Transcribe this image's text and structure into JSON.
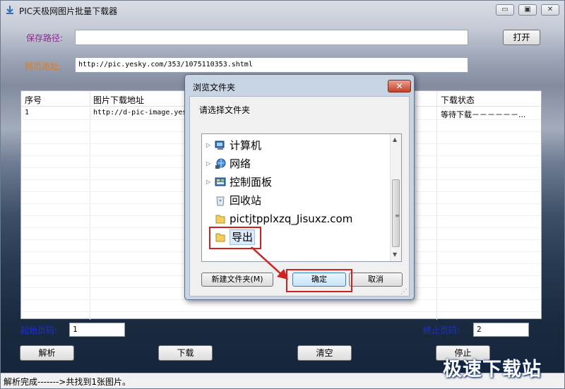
{
  "window": {
    "title": "PIC天极网图片批量下载器",
    "minimize": "▭",
    "maximize": "▣",
    "close": "✕"
  },
  "form": {
    "save_path_label": "保存路径:",
    "save_path_value": "",
    "open_button": "打开",
    "url_label": "网页地址:",
    "url_value": "http://pic.yesky.com/353/1075110353.shtml"
  },
  "table": {
    "columns": [
      "序号",
      "图片下载地址",
      "下载状态"
    ],
    "rows": [
      {
        "index": "1",
        "url": "http://d-pic-image.yes",
        "status": "等待下载－－－－－－..."
      }
    ]
  },
  "pages": {
    "start_label": "起始页码:",
    "start_value": "1",
    "end_label": "终止页码:",
    "end_value": "2"
  },
  "actions": {
    "parse": "解析",
    "download": "下载",
    "clear": "清空",
    "stop": "停止"
  },
  "status": "解析完成------->共找到1张图片。",
  "watermark": "极速下载站",
  "dialog": {
    "title": "浏览文件夹",
    "close": "✕",
    "prompt": "请选择文件夹",
    "tree": [
      {
        "label": "计算机",
        "icon": "computer-icon",
        "expandable": true
      },
      {
        "label": "网络",
        "icon": "network-icon",
        "expandable": true
      },
      {
        "label": "控制面板",
        "icon": "control-panel-icon",
        "expandable": true
      },
      {
        "label": "回收站",
        "icon": "recycle-bin-icon",
        "expandable": false
      },
      {
        "label": "pictjtpplxzq_Jisuxz.com",
        "icon": "folder-icon",
        "expandable": false
      },
      {
        "label": "导出",
        "icon": "folder-icon",
        "expandable": false,
        "selected": true
      }
    ],
    "new_folder": "新建文件夹(M)",
    "ok": "确定",
    "cancel": "取消"
  },
  "colors": {
    "label_purple": "#8b2d8f",
    "label_orange": "#e07b1c",
    "page_label_blue": "#1f2fd6",
    "highlight_red": "#d21f1f",
    "dialog_frame": "#c6d4e4"
  }
}
